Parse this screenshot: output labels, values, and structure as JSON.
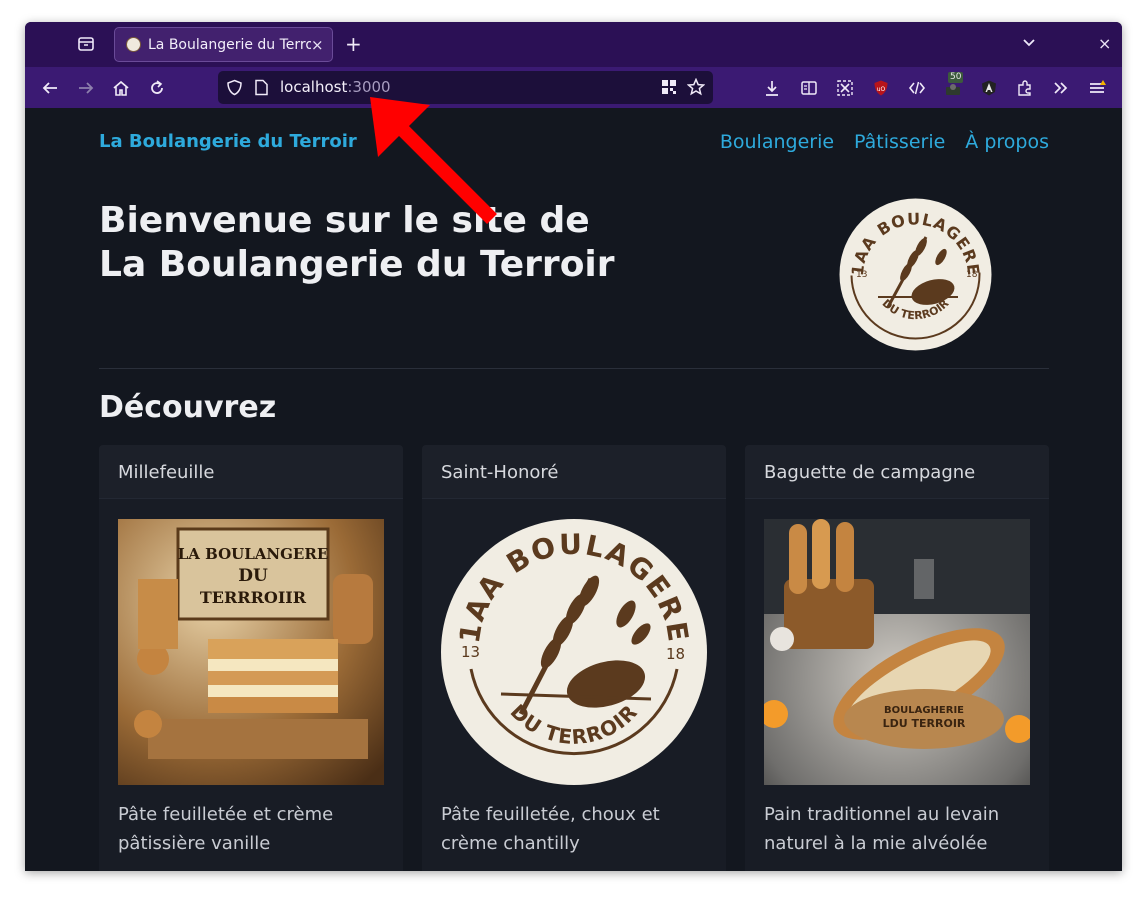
{
  "browser": {
    "tab": {
      "title": "La Boulangerie du Terroir",
      "close": "×"
    },
    "new_tab": "+",
    "window_close": "×",
    "url": {
      "host": "localhost",
      "port": ":3000"
    },
    "extension_badge": "50",
    "icons": [
      "tab-list-icon",
      "back-icon",
      "forward-icon",
      "home-icon",
      "reload-icon",
      "shield-icon",
      "page-icon",
      "qr-code-icon",
      "bookmark-star-icon",
      "download-icon",
      "reader-view-icon",
      "screenshot-icon",
      "ublock-icon",
      "devtools-icon",
      "extension-icon",
      "angular-icon",
      "puzzle-icon",
      "overflow-icon",
      "menu-icon"
    ]
  },
  "site": {
    "brand": "La Boulangerie du Terroir",
    "nav": [
      "Boulangerie",
      "Pâtisserie",
      "À propos"
    ],
    "hero": {
      "line1": "Bienvenue sur le site de",
      "line2": "La Boulangerie du Terroir"
    },
    "logo": {
      "top_text": "1AA BOULAGERE",
      "bottom_text": "DU TERROIR",
      "left_number": "13",
      "right_number": "18"
    },
    "section_title": "Découvrez",
    "cards": [
      {
        "title": "Millefeuille",
        "text": "Pâte feuilletée et crème pâtissière vanille",
        "img_sign_1": "LA BOULANGERE",
        "img_sign_2": "DU",
        "img_sign_3": "TERRROIIR"
      },
      {
        "title": "Saint-Honoré",
        "text": "Pâte feuilletée, choux et crème chantilly"
      },
      {
        "title": "Baguette de campagne",
        "text": "Pain traditionnel au levain naturel à la mie alvéolée",
        "img_board_1": "BOULAGHERIE",
        "img_board_2": "LDU TERROIR"
      }
    ]
  },
  "colors": {
    "tabstrip": "#2b1055",
    "toolbar": "#3b1a73",
    "page_bg": "#13171f",
    "link": "#2eaadc",
    "annotation_arrow": "#ff0000"
  }
}
